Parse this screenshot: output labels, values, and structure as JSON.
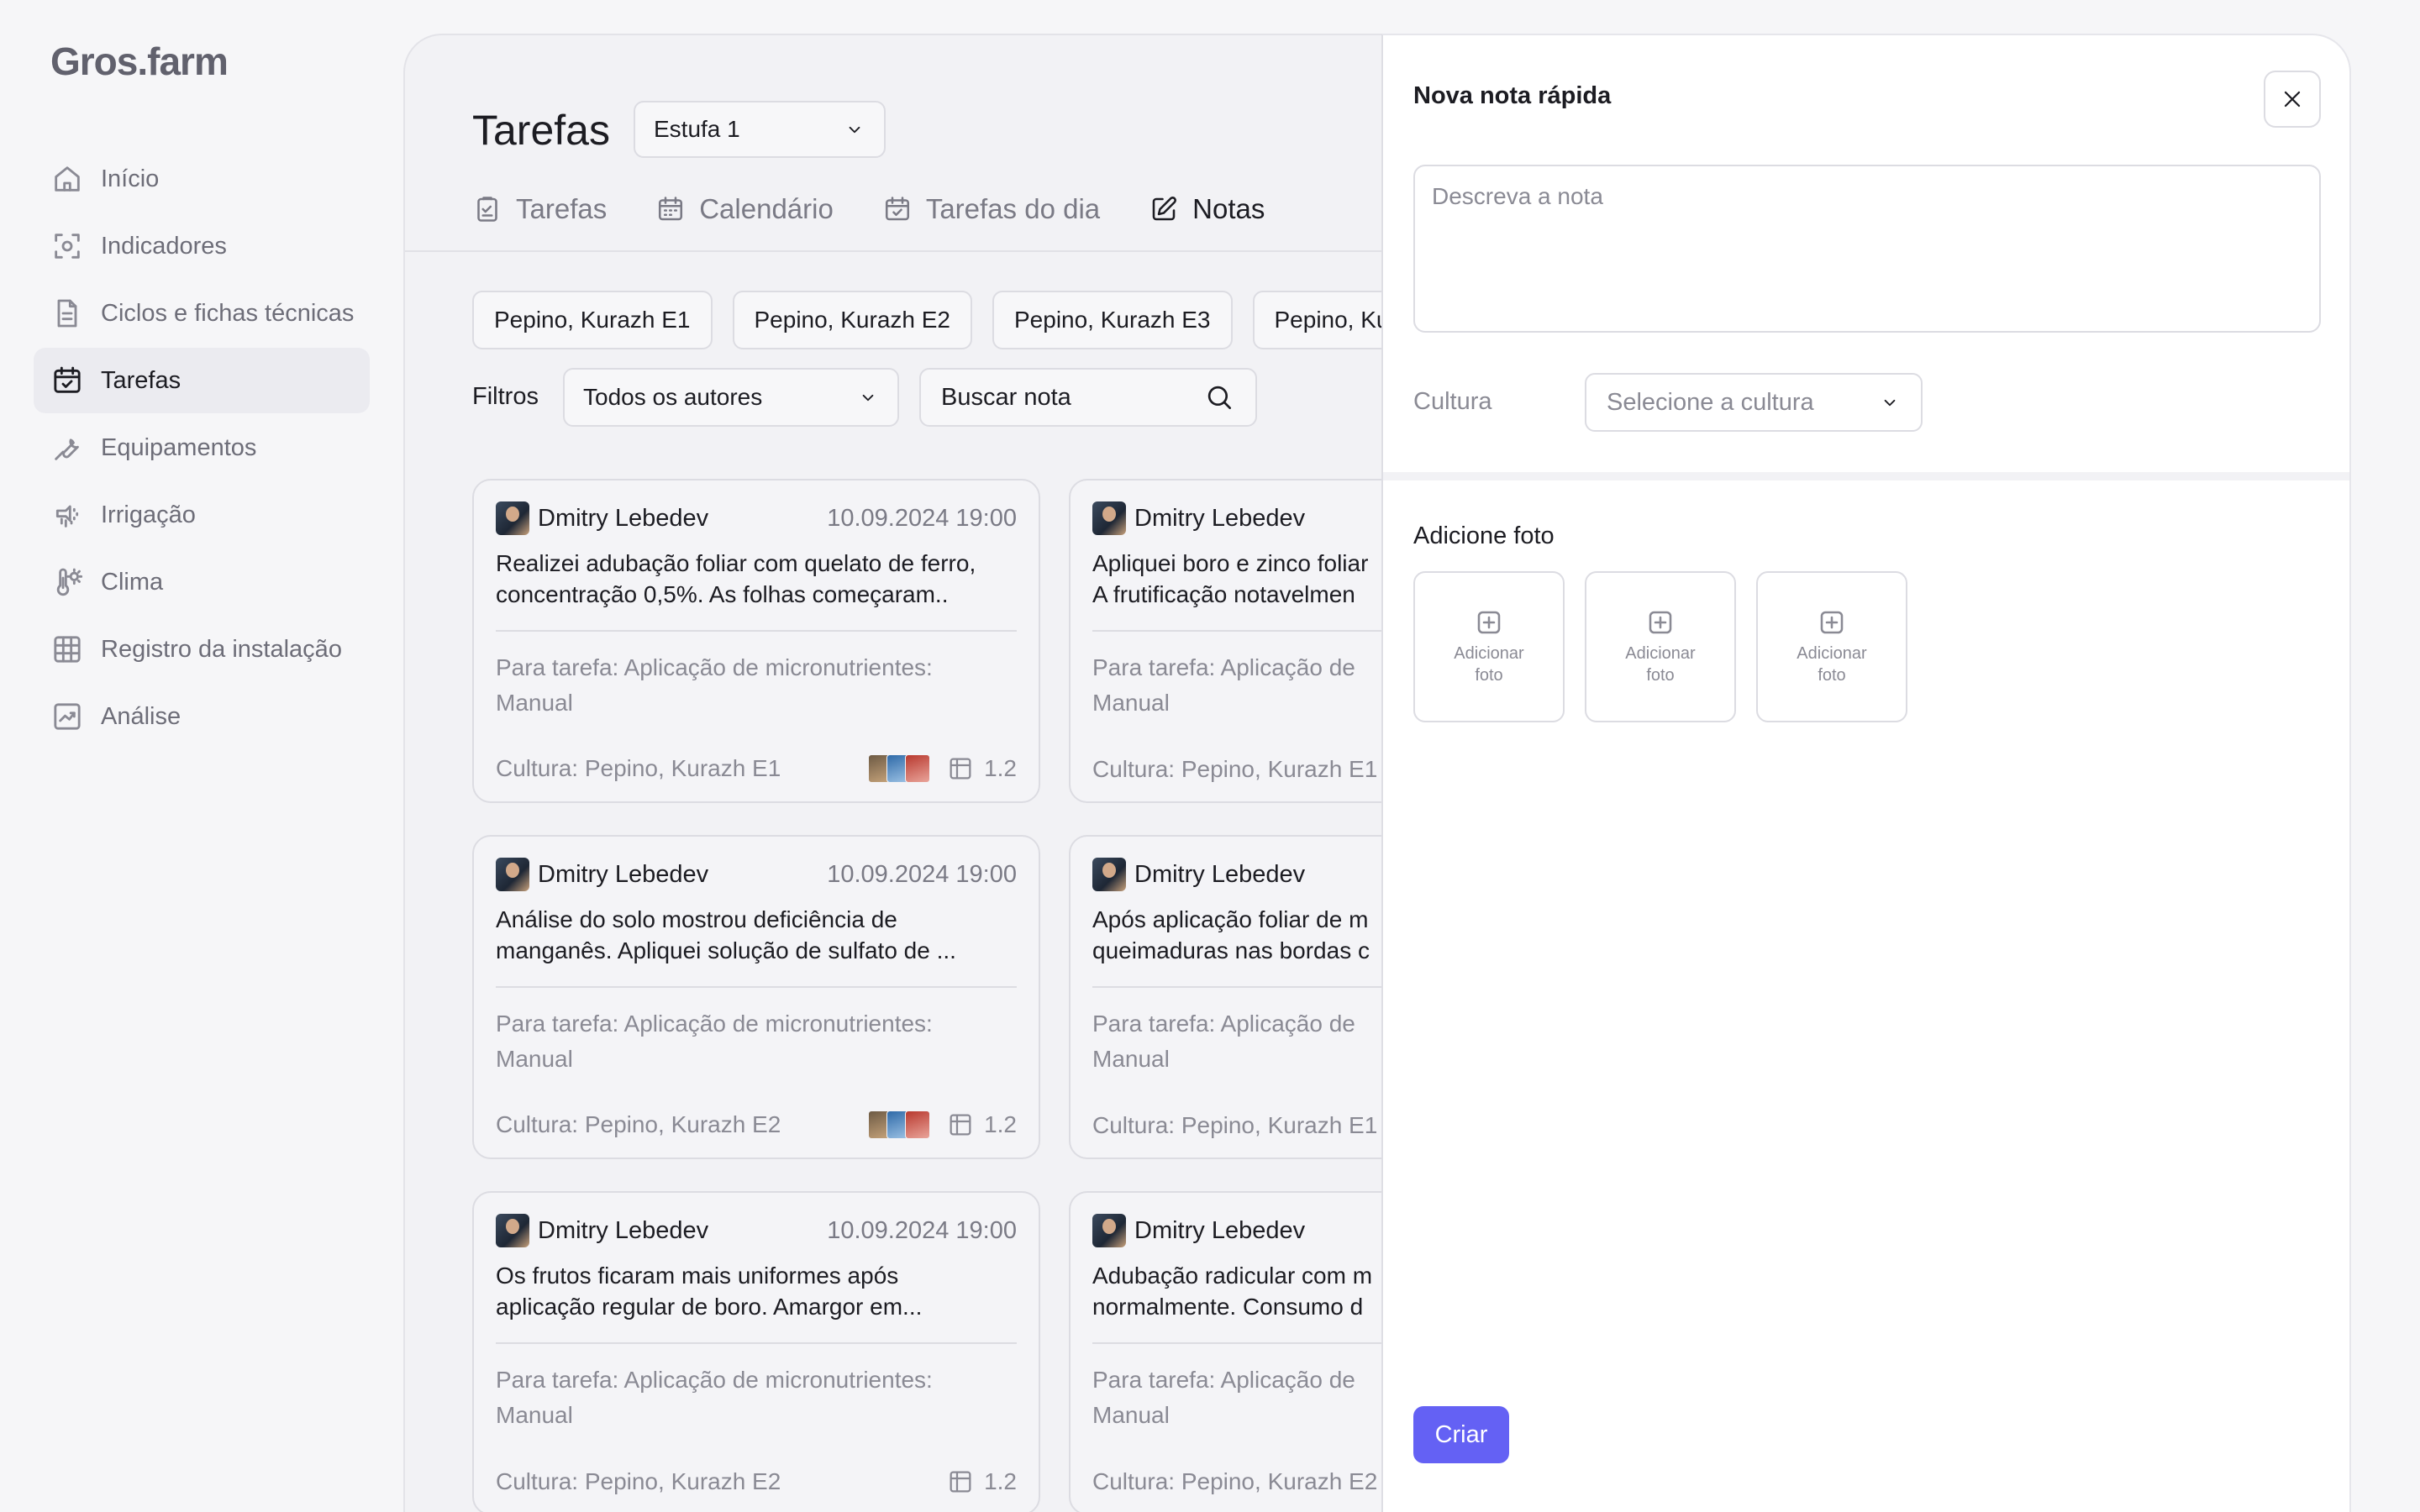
{
  "app": {
    "logo": "Gros.farm"
  },
  "sidebar": {
    "items": [
      {
        "label": "Início",
        "icon": "home-icon"
      },
      {
        "label": "Indicadores",
        "icon": "indicators-icon"
      },
      {
        "label": "Ciclos e fichas técnicas",
        "icon": "document-icon"
      },
      {
        "label": "Tarefas",
        "icon": "calendar-check-icon",
        "active": true
      },
      {
        "label": "Equipamentos",
        "icon": "wrench-icon"
      },
      {
        "label": "Irrigação",
        "icon": "irrigation-icon"
      },
      {
        "label": "Clima",
        "icon": "thermometer-sun-icon"
      },
      {
        "label": "Registro da instalação",
        "icon": "grid-icon"
      },
      {
        "label": "Análise",
        "icon": "chart-icon"
      }
    ]
  },
  "main": {
    "title": "Tarefas",
    "greenhouse_select": "Estufa 1",
    "tabs": [
      {
        "label": "Tarefas",
        "icon": "clipboard-icon"
      },
      {
        "label": "Calendário",
        "icon": "calendar-icon"
      },
      {
        "label": "Tarefas do dia",
        "icon": "calendar-check-icon"
      },
      {
        "label": "Notas",
        "icon": "edit-icon",
        "active": true
      }
    ],
    "chips": [
      "Pepino, Kurazh E1",
      "Pepino, Kurazh E2",
      "Pepino, Kurazh E3",
      "Pepino, Ku"
    ],
    "filters": {
      "label": "Filtros",
      "author_select": "Todos os autores",
      "search_placeholder": "Buscar nota"
    },
    "cards": [
      {
        "author": "Dmitry Lebedev",
        "date": "10.09.2024 19:00",
        "text_line1": "Realizei adubação foliar com quelato de ferro,",
        "text_line2": "concentração 0,5%. As folhas começaram..",
        "task_line1": "Para tarefa: Aplicação de micronutrientes:",
        "task_line2": "Manual",
        "culture": "Cultura: Pepino, Kurazh E1",
        "photos": true,
        "bed": "1.2"
      },
      {
        "author": "Dmitry Lebedev",
        "date": "",
        "text_line1": "Apliquei boro e zinco foliar",
        "text_line2": "A frutificação notavelmen",
        "task_line1": "Para tarefa: Aplicação de",
        "task_line2": "Manual",
        "culture": "Cultura: Pepino, Kurazh E1",
        "photos": false,
        "bed": ""
      },
      {
        "author": "Dmitry Lebedev",
        "date": "10.09.2024 19:00",
        "text_line1": "Análise do solo mostrou deficiência de",
        "text_line2": "manganês. Apliquei solução de sulfato de ...",
        "task_line1": "Para tarefa: Aplicação de micronutrientes:",
        "task_line2": "Manual",
        "culture": "Cultura: Pepino, Kurazh E2",
        "photos": true,
        "bed": "1.2"
      },
      {
        "author": "Dmitry Lebedev",
        "date": "",
        "text_line1": "Após aplicação foliar de m",
        "text_line2": "queimaduras nas bordas c",
        "task_line1": "Para tarefa: Aplicação de",
        "task_line2": "Manual",
        "culture": "Cultura: Pepino, Kurazh E1",
        "photos": false,
        "bed": ""
      },
      {
        "author": "Dmitry Lebedev",
        "date": "10.09.2024 19:00",
        "text_line1": "Os frutos ficaram mais uniformes após",
        "text_line2": "aplicação regular de boro. Amargor em...",
        "task_line1": "Para tarefa: Aplicação de micronutrientes:",
        "task_line2": "Manual",
        "culture": "Cultura: Pepino, Kurazh E2",
        "photos": false,
        "bed": "1.2"
      },
      {
        "author": "Dmitry Lebedev",
        "date": "",
        "text_line1": "Adubação radicular com m",
        "text_line2": "normalmente. Consumo d",
        "task_line1": "Para tarefa: Aplicação de",
        "task_line2": "Manual",
        "culture": "Cultura: Pepino, Kurazh E2",
        "photos": false,
        "bed": ""
      }
    ]
  },
  "panel": {
    "title": "Nova nota rápida",
    "note_placeholder": "Descreva a nota",
    "culture_label": "Cultura",
    "culture_placeholder": "Selecione a cultura",
    "photo_title": "Adicione foto",
    "photo_slots": [
      "Adicionar\nfoto",
      "Adicionar\nfoto",
      "Adicionar\nfoto"
    ],
    "create_label": "Criar"
  },
  "colors": {
    "accent": "#6461f4",
    "background": "#f6f6f8",
    "panel": "#ffffff"
  }
}
